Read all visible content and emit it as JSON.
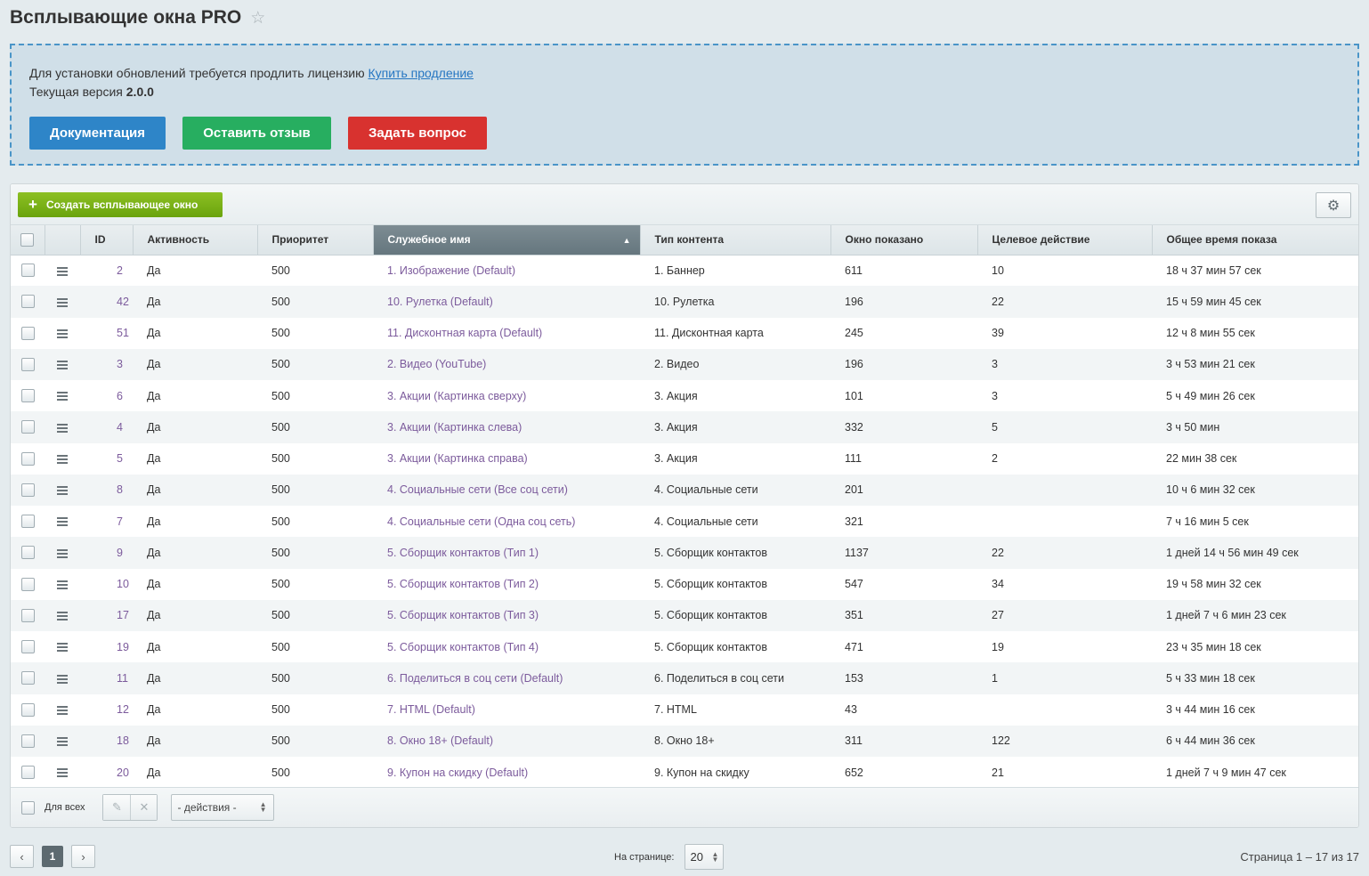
{
  "page": {
    "title": "Всплывающие окна PRO"
  },
  "notice": {
    "license_text": "Для установки обновлений требуется продлить лицензию",
    "license_link": "Купить продление",
    "version_label": "Текущая версия",
    "version_value": "2.0.0",
    "buttons": {
      "docs": "Документация",
      "review": "Оставить отзыв",
      "question": "Задать вопрос"
    },
    "colors": {
      "docs": "#2e85c8",
      "review": "#27ae60",
      "question": "#d8322f"
    }
  },
  "toolbar": {
    "create_label": "Создать всплывающее окно"
  },
  "table": {
    "columns": [
      "ID",
      "Активность",
      "Приоритет",
      "Служебное имя",
      "Тип контента",
      "Окно показано",
      "Целевое действие",
      "Общее время показа"
    ],
    "sorted_column": "Служебное имя",
    "rows": [
      {
        "id": "2",
        "active": "Да",
        "priority": "500",
        "name": "1. Изображение (Default)",
        "type": "1. Баннер",
        "shown": "611",
        "target": "10",
        "time": "18 ч 37 мин 57 сек"
      },
      {
        "id": "42",
        "active": "Да",
        "priority": "500",
        "name": "10. Рулетка (Default)",
        "type": "10. Рулетка",
        "shown": "196",
        "target": "22",
        "time": "15 ч 59 мин 45 сек"
      },
      {
        "id": "51",
        "active": "Да",
        "priority": "500",
        "name": "11. Дисконтная карта (Default)",
        "type": "11. Дисконтная карта",
        "shown": "245",
        "target": "39",
        "time": "12 ч 8 мин 55 сек"
      },
      {
        "id": "3",
        "active": "Да",
        "priority": "500",
        "name": "2. Видео (YouTube)",
        "type": "2. Видео",
        "shown": "196",
        "target": "3",
        "time": "3 ч 53 мин 21 сек"
      },
      {
        "id": "6",
        "active": "Да",
        "priority": "500",
        "name": "3. Акции (Картинка сверху)",
        "type": "3. Акция",
        "shown": "101",
        "target": "3",
        "time": "5 ч 49 мин 26 сек"
      },
      {
        "id": "4",
        "active": "Да",
        "priority": "500",
        "name": "3. Акции (Картинка слева)",
        "type": "3. Акция",
        "shown": "332",
        "target": "5",
        "time": "3 ч 50 мин"
      },
      {
        "id": "5",
        "active": "Да",
        "priority": "500",
        "name": "3. Акции (Картинка справа)",
        "type": "3. Акция",
        "shown": "111",
        "target": "2",
        "time": "22 мин 38 сек"
      },
      {
        "id": "8",
        "active": "Да",
        "priority": "500",
        "name": "4. Социальные сети (Все соц сети)",
        "type": "4. Социальные сети",
        "shown": "201",
        "target": "",
        "time": "10 ч 6 мин 32 сек"
      },
      {
        "id": "7",
        "active": "Да",
        "priority": "500",
        "name": "4. Социальные сети (Одна соц сеть)",
        "type": "4. Социальные сети",
        "shown": "321",
        "target": "",
        "time": "7 ч 16 мин 5 сек"
      },
      {
        "id": "9",
        "active": "Да",
        "priority": "500",
        "name": "5. Сборщик контактов (Тип 1)",
        "type": "5. Сборщик контактов",
        "shown": "1137",
        "target": "22",
        "time": "1 дней 14 ч 56 мин 49 сек"
      },
      {
        "id": "10",
        "active": "Да",
        "priority": "500",
        "name": "5. Сборщик контактов (Тип 2)",
        "type": "5. Сборщик контактов",
        "shown": "547",
        "target": "34",
        "time": "19 ч 58 мин 32 сек"
      },
      {
        "id": "17",
        "active": "Да",
        "priority": "500",
        "name": "5. Сборщик контактов (Тип 3)",
        "type": "5. Сборщик контактов",
        "shown": "351",
        "target": "27",
        "time": "1 дней 7 ч 6 мин 23 сек"
      },
      {
        "id": "19",
        "active": "Да",
        "priority": "500",
        "name": "5. Сборщик контактов (Тип 4)",
        "type": "5. Сборщик контактов",
        "shown": "471",
        "target": "19",
        "time": "23 ч 35 мин 18 сек"
      },
      {
        "id": "11",
        "active": "Да",
        "priority": "500",
        "name": "6. Поделиться в соц сети (Default)",
        "type": "6. Поделиться в соц сети",
        "shown": "153",
        "target": "1",
        "time": "5 ч 33 мин 18 сек"
      },
      {
        "id": "12",
        "active": "Да",
        "priority": "500",
        "name": "7. HTML (Default)",
        "type": "7. HTML",
        "shown": "43",
        "target": "",
        "time": "3 ч 44 мин 16 сек"
      },
      {
        "id": "18",
        "active": "Да",
        "priority": "500",
        "name": "8. Окно 18+ (Default)",
        "type": "8. Окно 18+",
        "shown": "311",
        "target": "122",
        "time": "6 ч 44 мин 36 сек"
      },
      {
        "id": "20",
        "active": "Да",
        "priority": "500",
        "name": "9. Купон на скидку (Default)",
        "type": "9. Купон на скидку",
        "shown": "652",
        "target": "21",
        "time": "1 дней 7 ч 9 мин 47 сек"
      }
    ]
  },
  "footer": {
    "for_all": "Для всех",
    "actions_select": "- действия -"
  },
  "pagination": {
    "current_page": "1",
    "per_page_label": "На странице:",
    "per_page_value": "20",
    "page_info": "Страница 1 – 17 из 17"
  },
  "icons": {
    "star": "star-icon",
    "gear": "gear-icon",
    "drag": "drag-handle-icon",
    "edit": "pencil-icon",
    "delete": "close-icon",
    "prev": "chevron-left-icon",
    "next": "chevron-right-icon"
  }
}
